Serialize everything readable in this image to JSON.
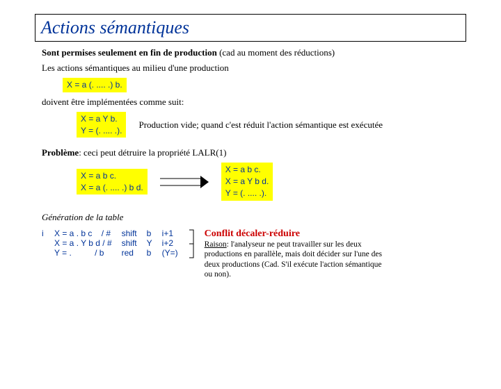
{
  "title": "Actions sémantiques",
  "line1_bold": "Sont permises seulement en fin de production",
  "line1_rest": " (cad au moment des réductions)",
  "line2": "Les actions sémantiques au milieu d'une production",
  "box1": "X = a (. .... .) b.",
  "line3": "doivent être implémentées comme suit:",
  "box2": "X = a Y b.\nY = (. .... .).",
  "note_right": "Production vide; quand c'est réduit l'action sémantique est exécutée",
  "problem_bold": "Problème",
  "problem_rest": ": ceci peut détruire la propriété LALR(1)",
  "box3": "X = a b c.\nX = a (. .... .) b d.",
  "box4": "X = a b c.\nX = a Y b d.\nY = (. .... .).",
  "gen_table": "Génération de la table",
  "table_i": "i",
  "col_grammar": "X = a . b c    / #\nX = a . Y b d / #\nY = .          / b",
  "col_action": "shift\nshift\nred",
  "col_sym": "b\nY\nb",
  "col_goto": "i+1\ni+2\n(Y=)",
  "conflict_title": "Conflit décaler-réduire",
  "raison_label": "Raison",
  "raison_text": ": l'analyseur ne peut  travailler sur les deux productions en parallèle, mais doit décider sur l'une des deux productions (Cad. S'il exécute l'action sémantique ou non)."
}
